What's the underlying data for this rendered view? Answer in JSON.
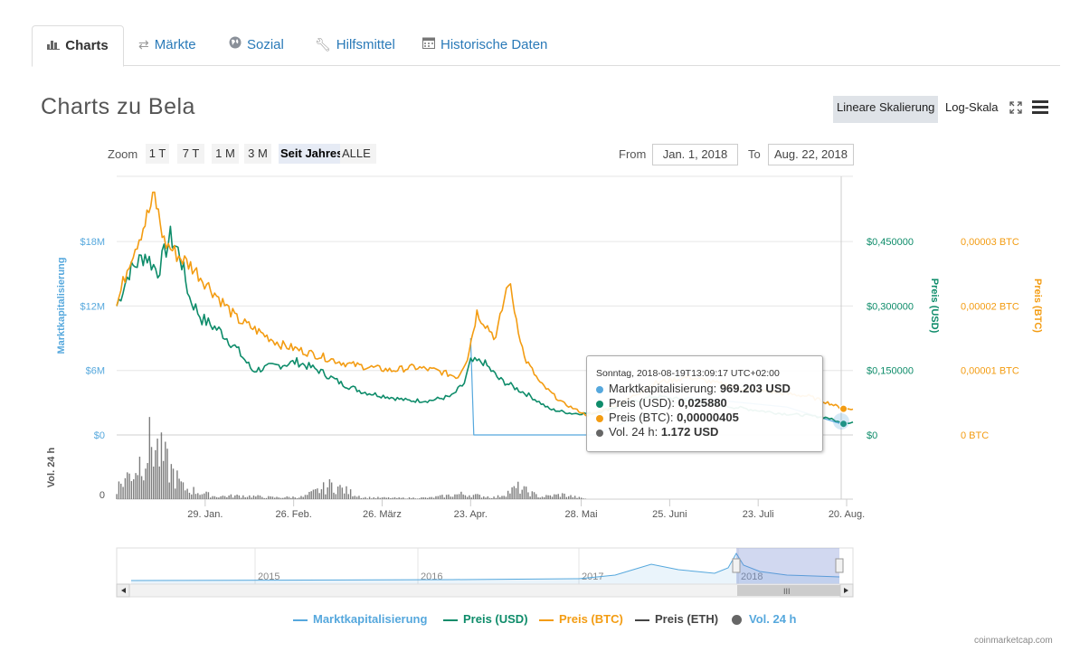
{
  "tabs": [
    {
      "label": "Charts",
      "icon": "bar-chart-icon"
    },
    {
      "label": "Märkte",
      "icon": "exchange-icon"
    },
    {
      "label": "Sozial",
      "icon": "globe-icon"
    },
    {
      "label": "Hilfsmittel",
      "icon": "wrench-icon"
    },
    {
      "label": "Historische Daten",
      "icon": "calendar-icon"
    }
  ],
  "page_title": "Charts zu Bela",
  "scale": {
    "linear": "Lineare Skalierung",
    "log": "Log-Skala",
    "selected": "linear"
  },
  "zoom": {
    "label": "Zoom",
    "buttons": [
      "1 T",
      "7 T",
      "1 M",
      "3 M",
      "Seit Jahresbeginn",
      "ALLE"
    ],
    "selected": "Seit Jahresbeginn"
  },
  "range": {
    "from_label": "From",
    "from": "Jan. 1, 2018",
    "to_label": "To",
    "to": "Aug. 22, 2018"
  },
  "colors": {
    "market_cap": "#56a8dd",
    "price_usd": "#0e8c6a",
    "price_btc": "#f39c12",
    "price_eth": "#444444",
    "volume": "#666666"
  },
  "chart_data": {
    "type": "line",
    "x_ticks": [
      "29. Jan.",
      "26. Feb.",
      "26. März",
      "23. Apr.",
      "28. Mai",
      "25. Juni",
      "23. Juli",
      "20. Aug."
    ],
    "axes": {
      "market_cap": {
        "label": "Marktkapitalisierung",
        "ticks": [
          "$0",
          "$6M",
          "$12M",
          "$18M"
        ],
        "range": [
          0,
          18000000
        ]
      },
      "price_usd": {
        "label": "Preis (USD)",
        "ticks": [
          "$0",
          "$0,150000",
          "$0,300000",
          "$0,450000"
        ],
        "range": [
          0,
          0.45
        ]
      },
      "price_btc": {
        "label": "Preis (BTC)",
        "ticks": [
          "0 BTC",
          "0,00001 BTC",
          "0,00002 BTC",
          "0,00003 BTC"
        ],
        "range": [
          0,
          3e-05
        ]
      },
      "volume": {
        "label": "Vol. 24 h",
        "ticks": [
          "0"
        ]
      }
    },
    "series": [
      {
        "name": "Marktkapitalisierung",
        "key": "market_cap",
        "x": [
          "2018-04-23",
          "2018-04-24",
          "2018-06-01",
          "2018-07-01",
          "2018-08-01",
          "2018-08-19"
        ],
        "values": [
          9000000,
          0,
          0,
          3500000,
          2600000,
          969203
        ]
      },
      {
        "name": "Preis (USD)",
        "key": "price_usd",
        "x": [
          "2018-01-01",
          "2018-01-05",
          "2018-01-10",
          "2018-01-14",
          "2018-01-18",
          "2018-01-21",
          "2018-01-24",
          "2018-01-28",
          "2018-02-03",
          "2018-02-08",
          "2018-02-13",
          "2018-02-20",
          "2018-02-27",
          "2018-03-06",
          "2018-03-13",
          "2018-03-20",
          "2018-03-27",
          "2018-04-03",
          "2018-04-10",
          "2018-04-17",
          "2018-04-21",
          "2018-04-23",
          "2018-04-27",
          "2018-05-02",
          "2018-05-07",
          "2018-05-12",
          "2018-05-18",
          "2018-05-25",
          "2018-06-01",
          "2018-06-10",
          "2018-06-20",
          "2018-07-01",
          "2018-07-10",
          "2018-07-20",
          "2018-07-30",
          "2018-08-08",
          "2018-08-14",
          "2018-08-19",
          "2018-08-22"
        ],
        "values": [
          0.3,
          0.38,
          0.42,
          0.38,
          0.46,
          0.42,
          0.32,
          0.27,
          0.24,
          0.2,
          0.15,
          0.16,
          0.17,
          0.15,
          0.12,
          0.1,
          0.09,
          0.08,
          0.08,
          0.09,
          0.12,
          0.17,
          0.17,
          0.13,
          0.11,
          0.09,
          0.06,
          0.05,
          0.05,
          0.07,
          0.09,
          0.08,
          0.07,
          0.06,
          0.05,
          0.045,
          0.04,
          0.02588,
          0.03
        ]
      },
      {
        "name": "Preis (BTC)",
        "key": "price_btc",
        "x": [
          "2018-01-01",
          "2018-01-05",
          "2018-01-10",
          "2018-01-13",
          "2018-01-16",
          "2018-01-20",
          "2018-01-25",
          "2018-02-01",
          "2018-02-08",
          "2018-02-15",
          "2018-02-22",
          "2018-03-01",
          "2018-03-08",
          "2018-03-15",
          "2018-03-22",
          "2018-03-29",
          "2018-04-05",
          "2018-04-12",
          "2018-04-19",
          "2018-04-22",
          "2018-04-25",
          "2018-05-01",
          "2018-05-05",
          "2018-05-10",
          "2018-05-15",
          "2018-05-22",
          "2018-05-30",
          "2018-06-10",
          "2018-06-20",
          "2018-07-01",
          "2018-07-10",
          "2018-07-20",
          "2018-07-30",
          "2018-08-08",
          "2018-08-14",
          "2018-08-19",
          "2018-08-22"
        ],
        "values": [
          2e-05,
          2.7e-05,
          3.3e-05,
          3.7e-05,
          3e-05,
          2.8e-05,
          2.6e-05,
          2.2e-05,
          1.8e-05,
          1.6e-05,
          1.4e-05,
          1.3e-05,
          1.2e-05,
          1.1e-05,
          1.05e-05,
          1e-05,
          1.05e-05,
          1e-05,
          9e-06,
          1.2e-05,
          1.9e-05,
          1.5e-05,
          2.4e-05,
          1.2e-05,
          8e-06,
          5e-06,
          3e-06,
          5e-06,
          8e-06,
          9e-06,
          8e-06,
          7e-06,
          6.5e-06,
          6e-06,
          5e-06,
          4.05e-06,
          4e-06
        ]
      },
      {
        "name": "Vol. 24 h",
        "key": "volume",
        "x": [
          "2018-01-01",
          "2018-01-07",
          "2018-01-12",
          "2018-01-17",
          "2018-01-22",
          "2018-02-01",
          "2018-02-10",
          "2018-02-20",
          "2018-03-01",
          "2018-03-10",
          "2018-03-20",
          "2018-04-01",
          "2018-04-10",
          "2018-04-20",
          "2018-05-01",
          "2018-05-08",
          "2018-05-15",
          "2018-05-22",
          "2018-05-30"
        ],
        "values": [
          20000,
          55000,
          100000,
          60000,
          20000,
          5000,
          6000,
          3000,
          4000,
          25000,
          3000,
          2000,
          2500,
          9000,
          3000,
          20000,
          4000,
          8000,
          0
        ]
      }
    ],
    "navigator": {
      "x_ticks": [
        "2015",
        "2016",
        "2017",
        "2018"
      ]
    },
    "tooltip": {
      "date": "Sonntag, 2018-08-19T13:09:17 UTC+02:00",
      "rows": [
        {
          "label": "Marktkapitalisierung: ",
          "value": "969.203 USD",
          "color": "#56a8dd"
        },
        {
          "label": "Preis (USD): ",
          "value": "0,025880",
          "color": "#0e8c6a"
        },
        {
          "label": "Preis (BTC): ",
          "value": "0,00000405",
          "color": "#f39c12"
        },
        {
          "label": "Vol. 24 h: ",
          "value": "1.172 USD",
          "color": "#666666"
        }
      ]
    },
    "grid": true,
    "legend_position": "bottom"
  },
  "legend": [
    {
      "label": "Marktkapitalisierung",
      "color": "#56a8dd",
      "shape": "line"
    },
    {
      "label": "Preis (USD)",
      "color": "#0e8c6a",
      "shape": "line"
    },
    {
      "label": "Preis (BTC)",
      "color": "#f39c12",
      "shape": "line"
    },
    {
      "label": "Preis (ETH)",
      "color": "#444444",
      "shape": "line"
    },
    {
      "label": "Vol. 24 h",
      "color": "#666666",
      "shape": "dot"
    }
  ],
  "credit": "coinmarketcap.com"
}
